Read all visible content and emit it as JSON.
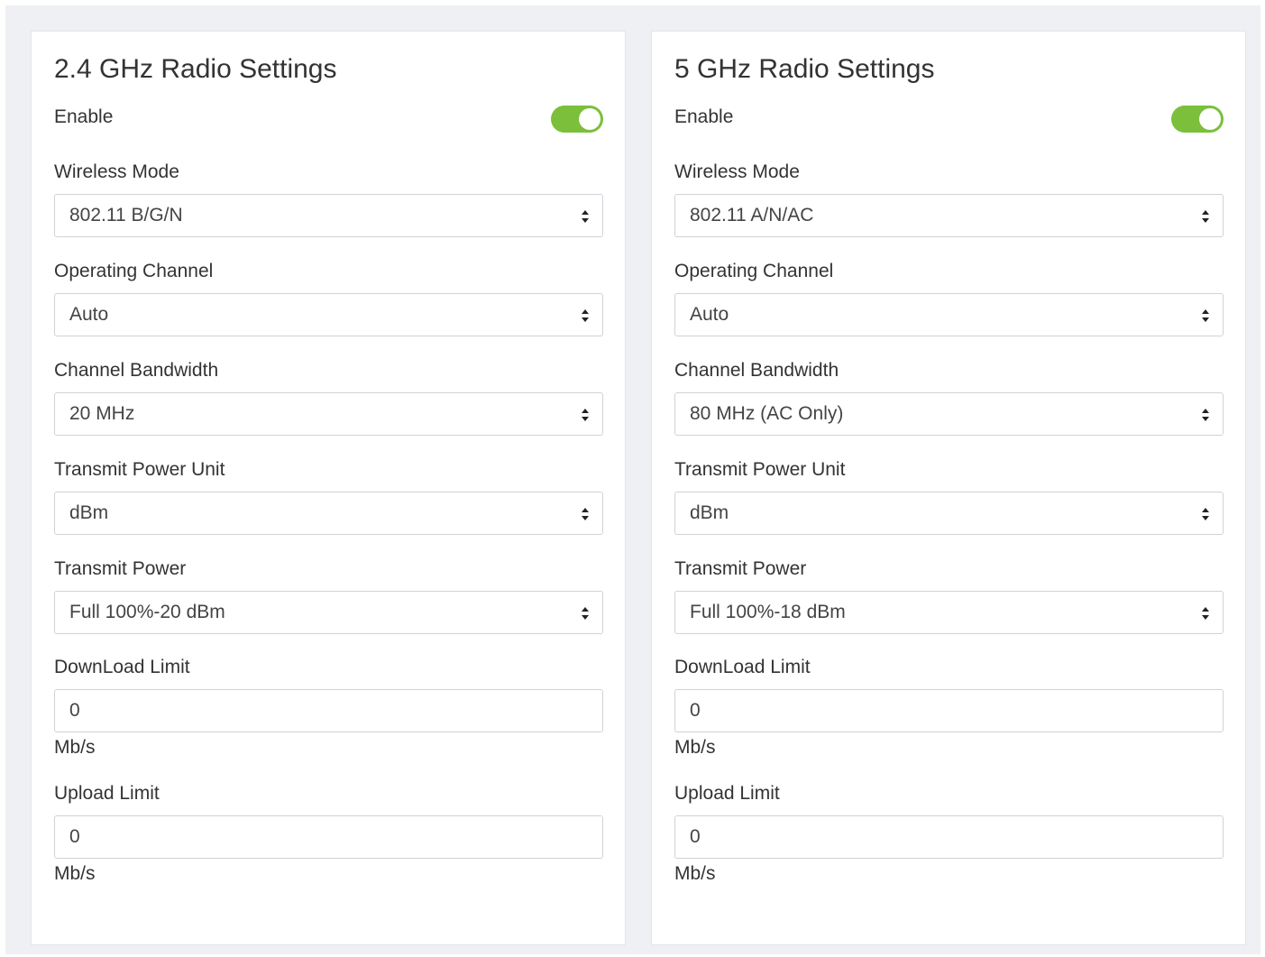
{
  "panels": [
    {
      "title": "2.4 GHz Radio Settings",
      "enable_label": "Enable",
      "enabled": true,
      "wireless_mode": {
        "label": "Wireless Mode",
        "value": "802.11 B/G/N"
      },
      "operating_channel": {
        "label": "Operating Channel",
        "value": "Auto"
      },
      "channel_bandwidth": {
        "label": "Channel Bandwidth",
        "value": "20 MHz"
      },
      "transmit_power_unit": {
        "label": "Transmit Power Unit",
        "value": "dBm"
      },
      "transmit_power": {
        "label": "Transmit Power",
        "value": "Full 100%-20 dBm"
      },
      "download_limit": {
        "label": "DownLoad Limit",
        "value": "0",
        "unit": "Mb/s"
      },
      "upload_limit": {
        "label": "Upload Limit",
        "value": "0",
        "unit": "Mb/s"
      }
    },
    {
      "title": "5 GHz Radio Settings",
      "enable_label": "Enable",
      "enabled": true,
      "wireless_mode": {
        "label": "Wireless Mode",
        "value": "802.11 A/N/AC"
      },
      "operating_channel": {
        "label": "Operating Channel",
        "value": "Auto"
      },
      "channel_bandwidth": {
        "label": "Channel Bandwidth",
        "value": "80 MHz (AC Only)"
      },
      "transmit_power_unit": {
        "label": "Transmit Power Unit",
        "value": "dBm"
      },
      "transmit_power": {
        "label": "Transmit Power",
        "value": "Full 100%-18 dBm"
      },
      "download_limit": {
        "label": "DownLoad Limit",
        "value": "0",
        "unit": "Mb/s"
      },
      "upload_limit": {
        "label": "Upload Limit",
        "value": "0",
        "unit": "Mb/s"
      }
    }
  ],
  "colors": {
    "toggle_on": "#7bbf3b",
    "page_bg": "#eef0f3",
    "panel_bg": "#ffffff",
    "border": "#cfd3d7"
  },
  "icons": {
    "select_arrow": "sort-icon",
    "toggle": "toggle-switch"
  }
}
